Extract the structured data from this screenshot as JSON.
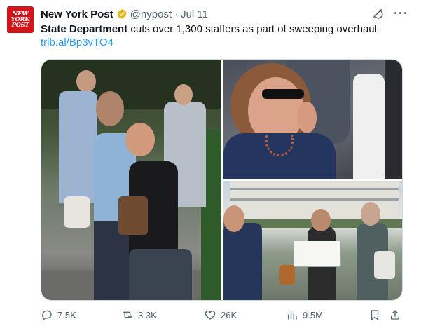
{
  "account": {
    "logo_text": [
      "NEW",
      "YORK",
      "POST"
    ],
    "name": "New York Post",
    "handle": "@nypost",
    "separator": "·",
    "date": "Jul 11",
    "verified_badge": "gold-verified-badge"
  },
  "tweet": {
    "text_bold": "State Department",
    "text_rest": " cuts over 1,300 staffers as part of sweeping overhaul",
    "link": "trib.al/Bp3vTO4"
  },
  "media": {
    "photos": [
      {
        "name": "photo-embrace",
        "description_icon": "photo"
      },
      {
        "name": "photo-woman-crying",
        "description_icon": "photo"
      },
      {
        "name": "photo-staffers-leaving",
        "description_icon": "photo"
      }
    ]
  },
  "actions": {
    "replies": "7.5K",
    "reposts": "3.3K",
    "likes": "26K",
    "views": "9.5M"
  },
  "colors": {
    "brand": "#d0151c",
    "link": "#1d9bf0",
    "muted": "#536471",
    "verified": "#e2b719"
  }
}
